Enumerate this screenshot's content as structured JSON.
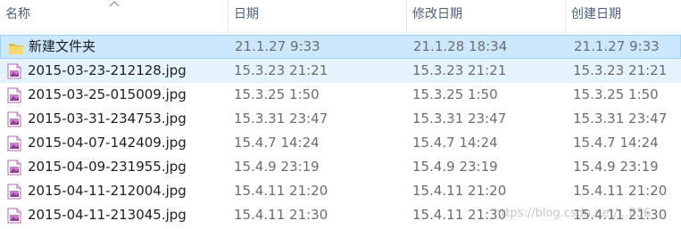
{
  "columns": {
    "name": "名称",
    "date": "日期",
    "modified": "修改日期",
    "created": "创建日期"
  },
  "rows": [
    {
      "type": "folder",
      "name": "新建文件夹",
      "date": "21.1.27 9:33",
      "modified": "21.1.28 18:34",
      "created": "21.1.27 9:33",
      "state": "selected"
    },
    {
      "type": "image",
      "name": "2015-03-23-212128.jpg",
      "date": "15.3.23 21:21",
      "modified": "15.3.23 21:21",
      "created": "15.3.23 21:21",
      "state": "hover"
    },
    {
      "type": "image",
      "name": "2015-03-25-015009.jpg",
      "date": "15.3.25 1:50",
      "modified": "15.3.25 1:50",
      "created": "15.3.25 1:50",
      "state": "normal"
    },
    {
      "type": "image",
      "name": "2015-03-31-234753.jpg",
      "date": "15.3.31 23:47",
      "modified": "15.3.31 23:47",
      "created": "15.3.31 23:47",
      "state": "normal"
    },
    {
      "type": "image",
      "name": "2015-04-07-142409.jpg",
      "date": "15.4.7 14:24",
      "modified": "15.4.7 14:24",
      "created": "15.4.7 14:24",
      "state": "normal"
    },
    {
      "type": "image",
      "name": "2015-04-09-231955.jpg",
      "date": "15.4.9 23:19",
      "modified": "15.4.9 23:19",
      "created": "15.4.9 23:19",
      "state": "normal"
    },
    {
      "type": "image",
      "name": "2015-04-11-212004.jpg",
      "date": "15.4.11 21:20",
      "modified": "15.4.11 21:20",
      "created": "15.4.11 21:20",
      "state": "normal"
    },
    {
      "type": "image",
      "name": "2015-04-11-213045.jpg",
      "date": "15.4.11 21:30",
      "modified": "15.4.11 21:30",
      "created": "15.4.11 21:30",
      "state": "normal"
    }
  ],
  "watermark": "https://blog.csdn.net/...836",
  "colors": {
    "selected_bg": "#cce8ff",
    "selected_border": "#99d1ff",
    "hover_bg": "#e5f3ff",
    "header_text": "#4c607a",
    "folder_yellow": "#f8d775",
    "image_icon_purple": "#b06ab3"
  },
  "icons": {
    "folder": "folder-icon",
    "image": "image-file-icon",
    "sort": "sort-ascending-caret-icon"
  }
}
